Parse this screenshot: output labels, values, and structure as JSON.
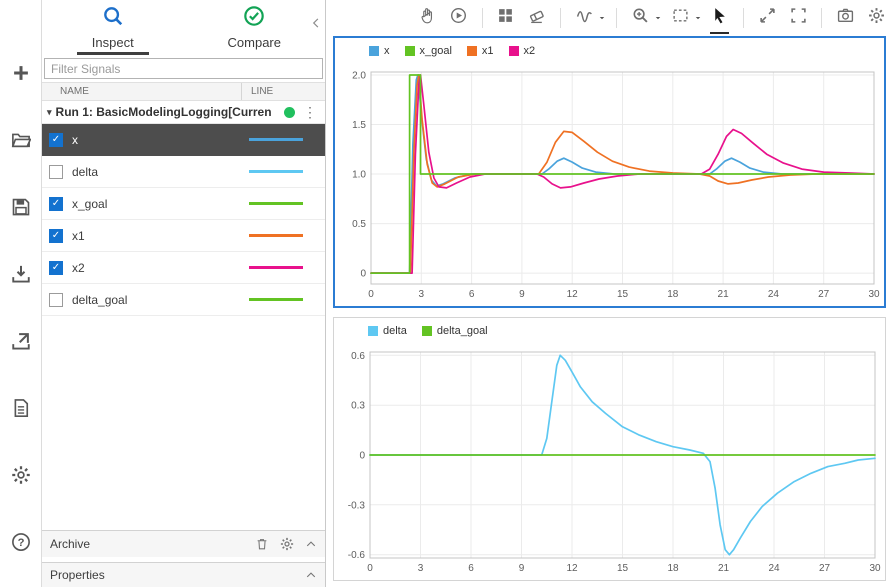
{
  "colors": {
    "inspect_icon": "#1d6fca",
    "compare_icon": "#12a355",
    "selection_border": "#2b7cd3",
    "selected_row_bg": "#4d4d4d",
    "run_status": "#21c05e"
  },
  "left_toolbar": {
    "items": [
      {
        "icon": "plus",
        "name": "new"
      },
      {
        "icon": "folder",
        "name": "open"
      },
      {
        "icon": "save",
        "name": "save"
      },
      {
        "icon": "import",
        "name": "import"
      },
      {
        "icon": "export",
        "name": "export"
      },
      {
        "icon": "report",
        "name": "create-report"
      },
      {
        "icon": "gear",
        "name": "preferences"
      },
      {
        "icon": "help",
        "name": "help"
      }
    ]
  },
  "tabs": {
    "inspect": "Inspect",
    "compare": "Compare"
  },
  "panel": {
    "filter_placeholder": "Filter Signals",
    "columns": [
      "NAME",
      "LINE"
    ],
    "run": {
      "label": "Run 1: BasicModelingLogging[Curren"
    },
    "signals": [
      {
        "name": "x",
        "checked": true,
        "selected": true,
        "color": "#4aa3dc"
      },
      {
        "name": "delta",
        "checked": false,
        "selected": false,
        "color": "#5ec8f2"
      },
      {
        "name": "x_goal",
        "checked": true,
        "selected": false,
        "color": "#63c323"
      },
      {
        "name": "x1",
        "checked": true,
        "selected": false,
        "color": "#ef7123"
      },
      {
        "name": "x2",
        "checked": true,
        "selected": false,
        "color": "#e8118c"
      },
      {
        "name": "delta_goal",
        "checked": false,
        "selected": false,
        "color": "#63c323"
      }
    ],
    "archive": {
      "label": "Archive"
    },
    "properties": {
      "label": "Properties"
    }
  },
  "toolbar": {
    "groups": [
      {
        "items": [
          {
            "icon": "hand",
            "name": "pan-tool"
          },
          {
            "icon": "play",
            "name": "replay"
          }
        ]
      },
      {
        "items": [
          {
            "icon": "layout",
            "name": "subplot-layout"
          },
          {
            "icon": "eraser",
            "name": "clear-plots"
          }
        ]
      },
      {
        "items": [
          {
            "icon": "wave",
            "name": "signal-style",
            "caret": true
          }
        ]
      },
      {
        "items": [
          {
            "icon": "zoom-in",
            "name": "zoom",
            "caret": true
          },
          {
            "icon": "zoom-box",
            "name": "zoom-region",
            "caret": true
          },
          {
            "icon": "cursor",
            "name": "pointer-tool",
            "active": true
          }
        ]
      },
      {
        "items": [
          {
            "icon": "expand",
            "name": "fit-to-view"
          },
          {
            "icon": "fullscreen",
            "name": "maximize"
          }
        ]
      },
      {
        "items": [
          {
            "icon": "camera",
            "name": "snapshot"
          },
          {
            "icon": "gear",
            "name": "plot-settings"
          }
        ]
      }
    ]
  },
  "chart_data": [
    {
      "type": "line",
      "title": "",
      "xlabel": "",
      "ylabel": "",
      "grid": true,
      "legend_position": "top-left",
      "xlim": [
        0,
        30
      ],
      "ylim": [
        -0.11,
        2.03
      ],
      "x_ticks": [
        0,
        3,
        6,
        9,
        12,
        15,
        18,
        21,
        24,
        27,
        30
      ],
      "y_ticks": [
        0,
        0.5,
        1,
        1.5,
        2
      ],
      "y_tick_labels": [
        "0",
        "0.5",
        "1.0",
        "1.5",
        "2.0"
      ],
      "draw_order": [
        0,
        2,
        3,
        1
      ],
      "series": [
        {
          "name": "x",
          "color": "#4aa3dc",
          "points": [
            [
              0,
              0
            ],
            [
              2.3,
              0
            ],
            [
              2.5,
              1.3
            ],
            [
              2.7,
              1.95
            ],
            [
              2.8,
              2.0
            ],
            [
              3.0,
              1.6
            ],
            [
              3.3,
              1.15
            ],
            [
              3.6,
              0.94
            ],
            [
              3.9,
              0.88
            ],
            [
              4.3,
              0.9
            ],
            [
              5,
              0.96
            ],
            [
              6,
              1
            ],
            [
              10.2,
              1
            ],
            [
              10.6,
              1.05
            ],
            [
              11.1,
              1.13
            ],
            [
              11.5,
              1.16
            ],
            [
              12,
              1.12
            ],
            [
              12.6,
              1.06
            ],
            [
              13.4,
              1.02
            ],
            [
              14.5,
              1
            ],
            [
              20.2,
              1
            ],
            [
              20.6,
              1.05
            ],
            [
              21.1,
              1.13
            ],
            [
              21.5,
              1.16
            ],
            [
              22,
              1.12
            ],
            [
              22.6,
              1.06
            ],
            [
              23.4,
              1.02
            ],
            [
              24.5,
              1
            ],
            [
              30,
              1
            ]
          ]
        },
        {
          "name": "x_goal",
          "color": "#63c323",
          "points": [
            [
              0,
              0
            ],
            [
              2.3,
              0
            ],
            [
              2.3,
              2
            ],
            [
              2.95,
              2
            ],
            [
              2.95,
              1
            ],
            [
              30,
              1
            ]
          ]
        },
        {
          "name": "x1",
          "color": "#ef7123",
          "points": [
            [
              0,
              0
            ],
            [
              2.35,
              0
            ],
            [
              2.55,
              1.2
            ],
            [
              2.75,
              1.9
            ],
            [
              2.85,
              2.0
            ],
            [
              3.05,
              1.55
            ],
            [
              3.35,
              1.1
            ],
            [
              3.65,
              0.91
            ],
            [
              3.95,
              0.87
            ],
            [
              4.4,
              0.9
            ],
            [
              5.2,
              0.97
            ],
            [
              6.2,
              1
            ],
            [
              10,
              1
            ],
            [
              10.5,
              1.12
            ],
            [
              11,
              1.32
            ],
            [
              11.5,
              1.43
            ],
            [
              12,
              1.42
            ],
            [
              12.7,
              1.33
            ],
            [
              13.5,
              1.22
            ],
            [
              14.4,
              1.13
            ],
            [
              15.4,
              1.07
            ],
            [
              16.6,
              1.03
            ],
            [
              18,
              1.01
            ],
            [
              19.6,
              1
            ],
            [
              20.2,
              0.98
            ],
            [
              20.7,
              0.93
            ],
            [
              21.3,
              0.9
            ],
            [
              21.9,
              0.91
            ],
            [
              22.7,
              0.94
            ],
            [
              23.7,
              0.97
            ],
            [
              25,
              0.99
            ],
            [
              26.5,
              1
            ],
            [
              30,
              1
            ]
          ]
        },
        {
          "name": "x2",
          "color": "#e8118c",
          "points": [
            [
              0,
              0
            ],
            [
              2.45,
              0
            ],
            [
              2.65,
              1.2
            ],
            [
              2.85,
              1.9
            ],
            [
              2.95,
              2.0
            ],
            [
              3.15,
              1.7
            ],
            [
              3.45,
              1.22
            ],
            [
              3.75,
              0.96
            ],
            [
              4.05,
              0.87
            ],
            [
              4.5,
              0.86
            ],
            [
              5.1,
              0.91
            ],
            [
              5.9,
              0.97
            ],
            [
              6.8,
              1
            ],
            [
              9.9,
              1
            ],
            [
              10.3,
              0.97
            ],
            [
              10.8,
              0.9
            ],
            [
              11.3,
              0.86
            ],
            [
              11.9,
              0.87
            ],
            [
              12.7,
              0.91
            ],
            [
              13.6,
              0.95
            ],
            [
              14.7,
              0.98
            ],
            [
              16,
              1
            ],
            [
              19.7,
              1
            ],
            [
              20.2,
              1.05
            ],
            [
              20.7,
              1.2
            ],
            [
              21.2,
              1.38
            ],
            [
              21.6,
              1.45
            ],
            [
              22.1,
              1.41
            ],
            [
              22.8,
              1.31
            ],
            [
              23.6,
              1.2
            ],
            [
              24.6,
              1.11
            ],
            [
              25.7,
              1.05
            ],
            [
              27,
              1.02
            ],
            [
              28.5,
              1.01
            ],
            [
              30,
              1
            ]
          ]
        }
      ]
    },
    {
      "type": "line",
      "title": "",
      "xlabel": "",
      "ylabel": "",
      "grid": true,
      "legend_position": "top-left",
      "xlim": [
        0,
        30
      ],
      "ylim": [
        -0.62,
        0.62
      ],
      "x_ticks": [
        0,
        3,
        6,
        9,
        12,
        15,
        18,
        21,
        24,
        27,
        30
      ],
      "y_ticks": [
        -0.6,
        -0.3,
        0,
        0.3,
        0.6
      ],
      "y_tick_labels": [
        "-0.6",
        "-0.3",
        "0",
        "0.3",
        "0.6"
      ],
      "draw_order": [
        0,
        1
      ],
      "series": [
        {
          "name": "delta",
          "color": "#5ec8f2",
          "points": [
            [
              0,
              0
            ],
            [
              10.2,
              0
            ],
            [
              10.5,
              0.1
            ],
            [
              10.8,
              0.32
            ],
            [
              11.1,
              0.54
            ],
            [
              11.3,
              0.6
            ],
            [
              11.6,
              0.57
            ],
            [
              12,
              0.5
            ],
            [
              12.5,
              0.41
            ],
            [
              13.2,
              0.32
            ],
            [
              14,
              0.25
            ],
            [
              15,
              0.17
            ],
            [
              16,
              0.12
            ],
            [
              17,
              0.08
            ],
            [
              18,
              0.05
            ],
            [
              19,
              0.03
            ],
            [
              19.8,
              0.01
            ],
            [
              20.2,
              -0.04
            ],
            [
              20.5,
              -0.2
            ],
            [
              20.8,
              -0.42
            ],
            [
              21.1,
              -0.57
            ],
            [
              21.35,
              -0.6
            ],
            [
              21.6,
              -0.57
            ],
            [
              22,
              -0.5
            ],
            [
              22.6,
              -0.4
            ],
            [
              23.3,
              -0.31
            ],
            [
              24.2,
              -0.23
            ],
            [
              25.2,
              -0.16
            ],
            [
              26.2,
              -0.11
            ],
            [
              27.2,
              -0.07
            ],
            [
              28.2,
              -0.05
            ],
            [
              29,
              -0.03
            ],
            [
              30,
              -0.02
            ]
          ]
        },
        {
          "name": "delta_goal",
          "color": "#63c323",
          "points": [
            [
              0,
              0
            ],
            [
              30,
              0
            ]
          ]
        }
      ]
    }
  ]
}
